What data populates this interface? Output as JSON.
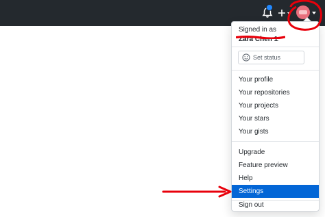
{
  "header": {
    "bell_icon": "bell-icon",
    "plus_icon": "plus-icon",
    "avatar_icon": "avatar",
    "notification_dot_color": "#2188ff"
  },
  "menu": {
    "signed_in_label": "Signed in as",
    "username": "Zara Chen 11",
    "set_status_label": "Set status",
    "items_group1": [
      {
        "label": "Your profile"
      },
      {
        "label": "Your repositories"
      },
      {
        "label": "Your projects"
      },
      {
        "label": "Your stars"
      },
      {
        "label": "Your gists"
      }
    ],
    "items_group2": [
      {
        "label": "Upgrade"
      },
      {
        "label": "Feature preview"
      },
      {
        "label": "Help"
      },
      {
        "label": "Settings"
      }
    ],
    "sign_out_label": "Sign out",
    "active_item": "Settings"
  },
  "colors": {
    "header_bg": "#24292e",
    "accent_blue": "#0366d6",
    "annotation_red": "#e8000b"
  }
}
